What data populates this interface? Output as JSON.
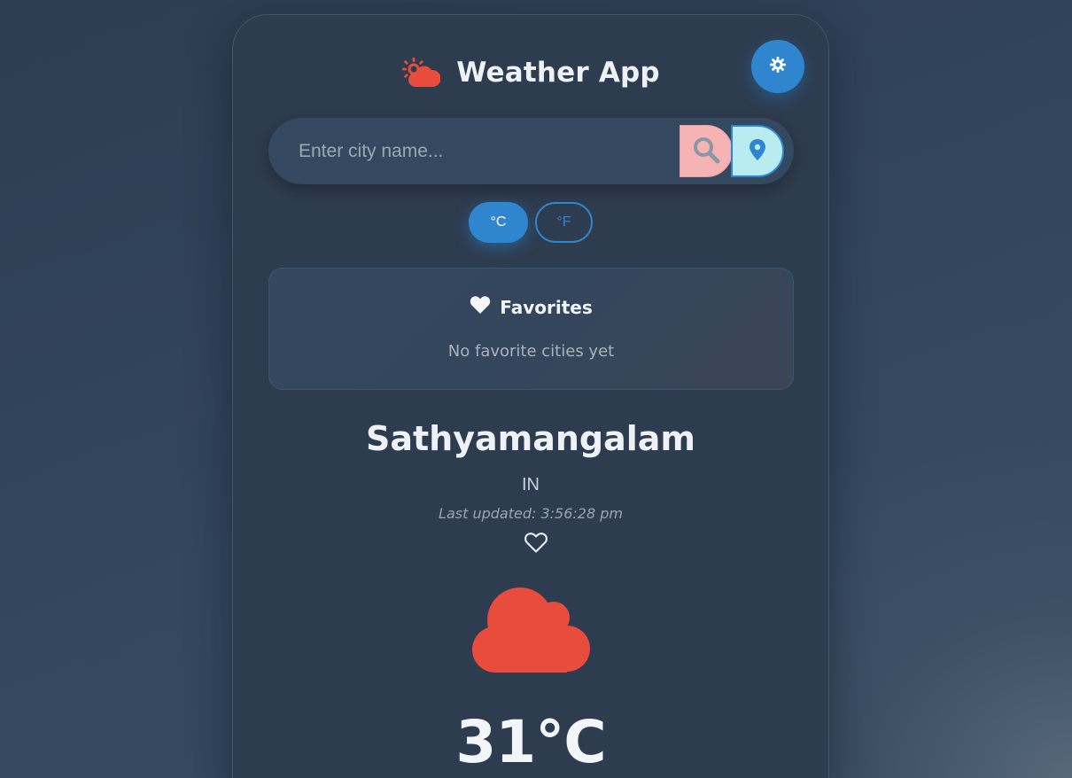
{
  "app": {
    "title": "Weather App",
    "logo_icon": "sun-behind-cloud-icon",
    "theme_toggle_icon": "gear-icon"
  },
  "search": {
    "placeholder": "Enter city name...",
    "value": "",
    "search_icon": "search-icon",
    "location_icon": "location-pin-icon"
  },
  "units": {
    "celsius_label": "°C",
    "fahrenheit_label": "°F",
    "selected": "celsius"
  },
  "favorites": {
    "title": "Favorites",
    "title_icon": "heart-icon",
    "empty_text": "No favorite cities yet"
  },
  "weather": {
    "city": "Sathyamangalam",
    "country": "IN",
    "last_updated": "Last updated: 3:56:28 pm",
    "favorite_icon": "heart-outline-icon",
    "condition_icon": "cloud-icon",
    "temperature": "31°C"
  },
  "colors": {
    "accent": "#2f86cf",
    "icon_red": "#e84c3d",
    "search_button_bg": "#f6b3b3",
    "location_button_bg": "#b9ecf0",
    "card_bg": "#2e3c4f"
  }
}
